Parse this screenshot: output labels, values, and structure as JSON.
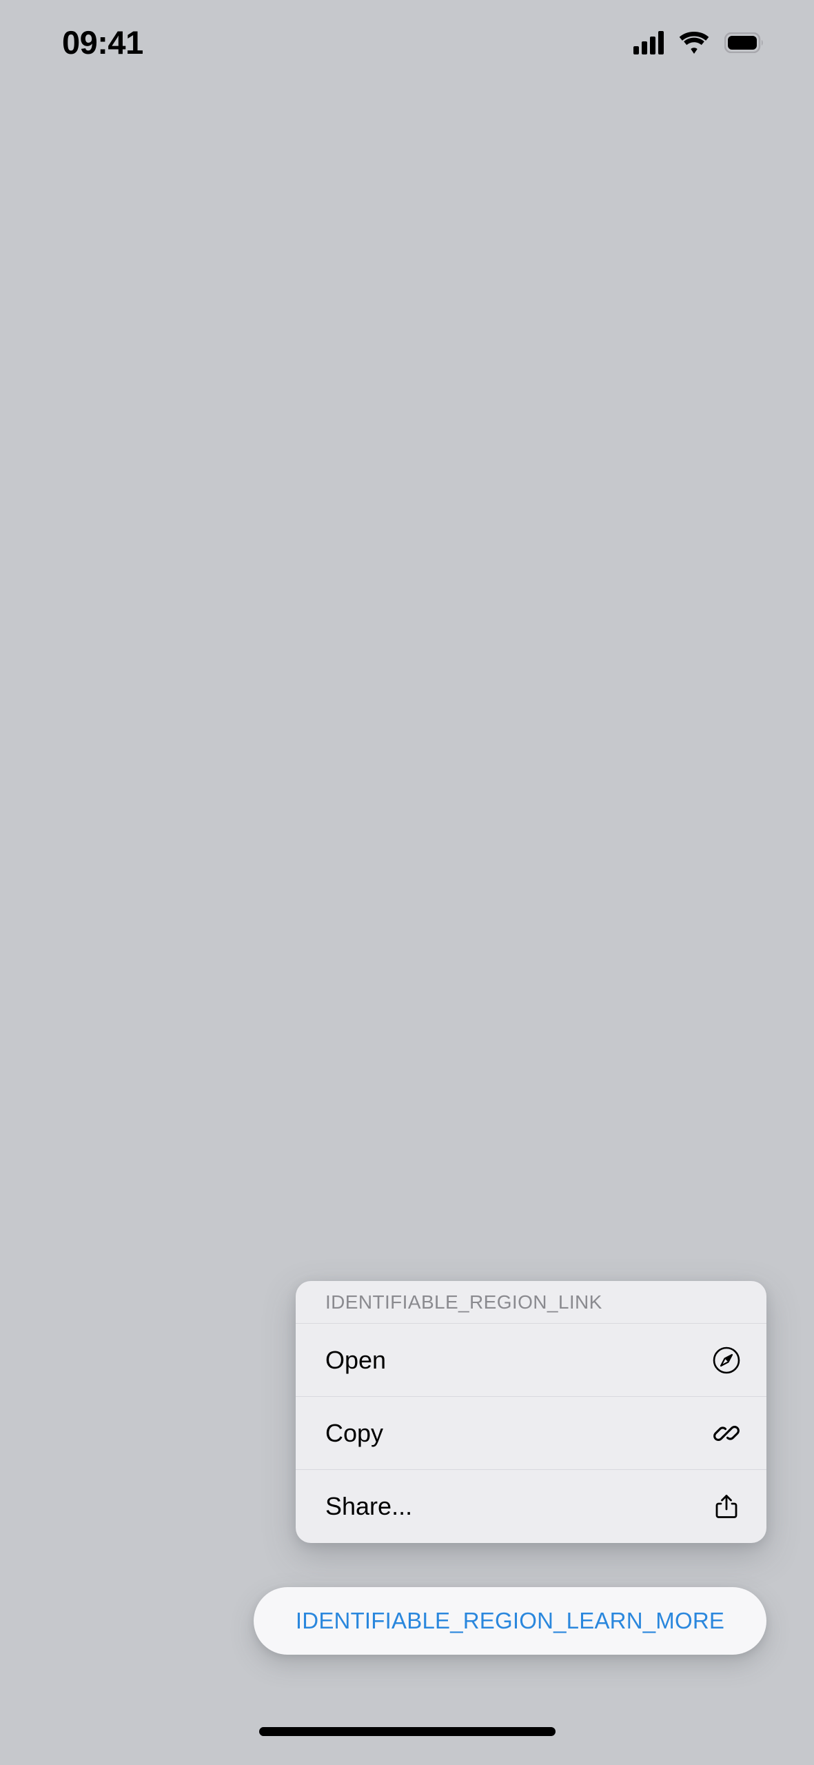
{
  "screen": {
    "background_color": "#c6c8cc"
  },
  "status_bar": {
    "time": "09:41",
    "cellular_icon": "cellular-bars-icon",
    "wifi_icon": "wifi-icon",
    "battery_icon": "battery-icon"
  },
  "context_menu": {
    "header": "IDENTIFIABLE_REGION_LINK",
    "background_color": "#ededf0",
    "items": [
      {
        "label": "Open",
        "icon": "safari-compass-icon"
      },
      {
        "label": "Copy",
        "icon": "link-chain-icon"
      },
      {
        "label": "Share...",
        "icon": "share-upload-icon"
      }
    ]
  },
  "learn_more_button": {
    "label": "IDENTIFIABLE_REGION_LEARN_MORE",
    "text_color": "#2a87dd",
    "background_color": "#f7f7f9"
  },
  "home_indicator": {
    "color": "#000000"
  }
}
